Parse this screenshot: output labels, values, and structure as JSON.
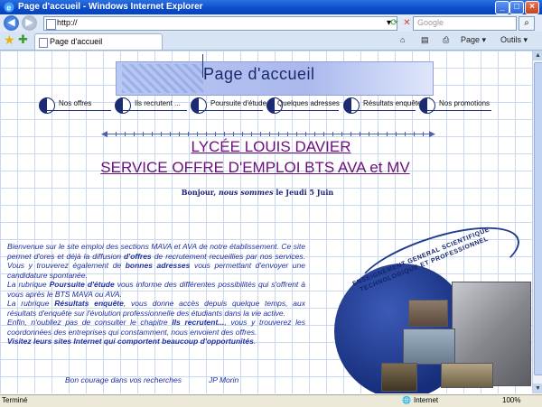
{
  "window": {
    "title": "Page d'accueil - Windows Internet Explorer"
  },
  "address": {
    "url": "http://"
  },
  "search": {
    "placeholder": "Google"
  },
  "tab": {
    "label": "Page d'accueil"
  },
  "toolbar": {
    "page_label": "Page",
    "tools_label": "Outils"
  },
  "header": {
    "title": "Page d'accueil"
  },
  "nav": {
    "items": [
      {
        "label": "Nos offres"
      },
      {
        "label": "Ils recrutent ..."
      },
      {
        "label": "Poursuite d'étude"
      },
      {
        "label": "Quelques adresses"
      },
      {
        "label": "Résultats enquête"
      },
      {
        "label": "Nos promotions"
      }
    ]
  },
  "school": {
    "name": "LYCÉE LOUIS DAVIER",
    "service": "SERVICE OFFRE D'EMPLOI BTS AVA et  MV"
  },
  "greeting": {
    "prefix": "Bonjour, ",
    "emph": "nous sommes",
    "suffix": " le Jeudi 5 Juin"
  },
  "intro": {
    "p1_a": "Bienvenue sur le site emploi des sections MAVA et AVA de notre établissement. Ce site permet d'ores et déjà la diffusion ",
    "p1_b": "d'offres",
    "p1_c": " de recrutement recueillies par nos services. Vous y trouverez également de ",
    "p1_d": "bonnes adresses",
    "p1_e": " vous permettant d'envoyer une candidature spontanée.",
    "p2_a": "La rubrique ",
    "p2_b": "Poursuite d'étude",
    "p2_c": " vous informe des différentes possibilités qui s'offrent à vous après le BTS MAVA ou AVA.",
    "p3_a": "La rubrique ",
    "p3_b": "Résultats enquête",
    "p3_c": ", vous donne accès depuis quelque temps, aux résultats d'enquête sur l'évolution professionnelle des étudiants dans la vie active.",
    "p4_a": "Enfin, n'oubliez pas de consulter le chapitre ",
    "p4_b": "Ils recrutent...",
    "p4_c": ", vous y trouverez les coordonnées des entreprises qui constamment, nous envoient des offres.",
    "p5": "Visitez leurs sites Internet qui comportent beaucoup d'opportunités",
    "p5_end": "."
  },
  "signature": {
    "text": "Bon courage dans vos recherches",
    "author": "JP Morin"
  },
  "collage": {
    "ring_text": "ENSEIGNEMENT GENERAL SCIENTIFIQUE TECHNOLOGIQUE ET PROFESSIONNEL"
  },
  "status": {
    "left": "Terminé",
    "zone": "Internet",
    "zoom": "100%"
  }
}
